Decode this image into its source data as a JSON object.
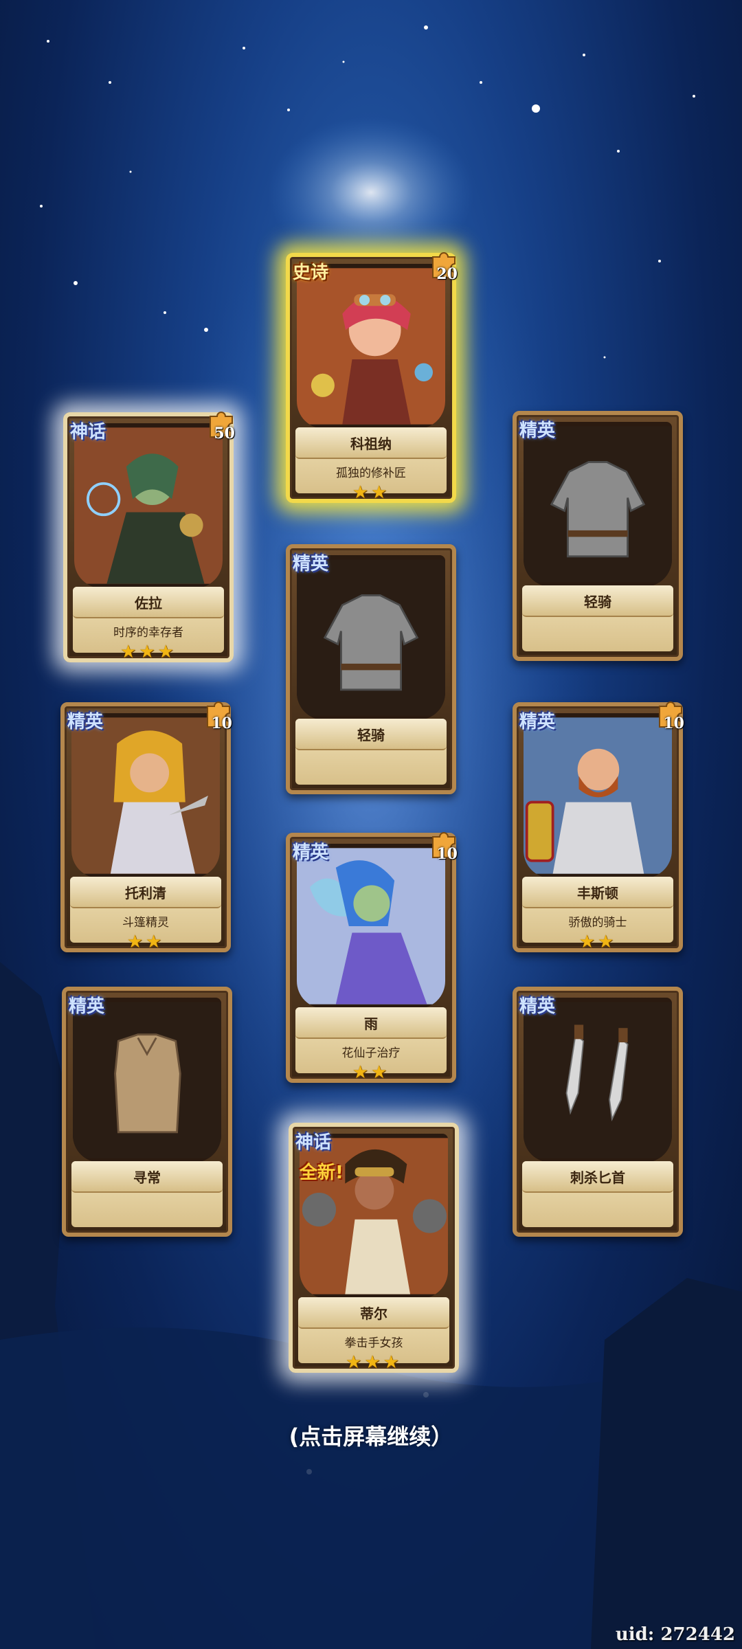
{
  "cards": [
    {
      "id": "c1",
      "rarity": "史诗",
      "name": "科祖纳",
      "title": "孤独的修补匠",
      "stars": "★★",
      "fragments": "20",
      "portrait": "hero-girl-goggles"
    },
    {
      "id": "c2",
      "rarity": "神话",
      "name": "佐拉",
      "title": "时序的幸存者",
      "stars": "★★★",
      "fragments": "50",
      "portrait": "hero-green-mage"
    },
    {
      "id": "c3",
      "rarity": "精英",
      "name": "轻骑",
      "title": "",
      "stars": "",
      "fragments": "",
      "portrait": "chainmail-armor"
    },
    {
      "id": "c4",
      "rarity": "精英",
      "name": "轻骑",
      "title": "",
      "stars": "",
      "fragments": "",
      "portrait": "chainmail-armor"
    },
    {
      "id": "c5",
      "rarity": "精英",
      "name": "托利清",
      "title": "斗篷精灵",
      "stars": "★★",
      "fragments": "10",
      "portrait": "hero-hooded-elf"
    },
    {
      "id": "c6",
      "rarity": "精英",
      "name": "丰斯顿",
      "title": "骄傲的骑士",
      "stars": "★★",
      "fragments": "10",
      "portrait": "hero-knight"
    },
    {
      "id": "c7",
      "rarity": "精英",
      "name": "雨",
      "title": "花仙子治疗",
      "stars": "★★",
      "fragments": "10",
      "portrait": "hero-fairy"
    },
    {
      "id": "c8",
      "rarity": "精英",
      "name": "寻常",
      "title": "",
      "stars": "",
      "fragments": "",
      "portrait": "cloth-shirt"
    },
    {
      "id": "c9",
      "rarity": "精英",
      "name": "刺杀匕首",
      "title": "",
      "stars": "",
      "fragments": "",
      "portrait": "twin-daggers"
    },
    {
      "id": "c10",
      "rarity": "神话",
      "new_label": "全新!",
      "name": "蒂尔",
      "title": "拳击手女孩",
      "stars": "★★★",
      "fragments": "",
      "portrait": "hero-boxer-girl"
    }
  ],
  "continue_text": "(点击屏幕继续）",
  "uid_text": "uid: 272442",
  "colors": {
    "epic_glow": "#ffec3c",
    "mythic_glow": "#ffffff",
    "star": "#f1b514",
    "frame": "#b4874d"
  }
}
